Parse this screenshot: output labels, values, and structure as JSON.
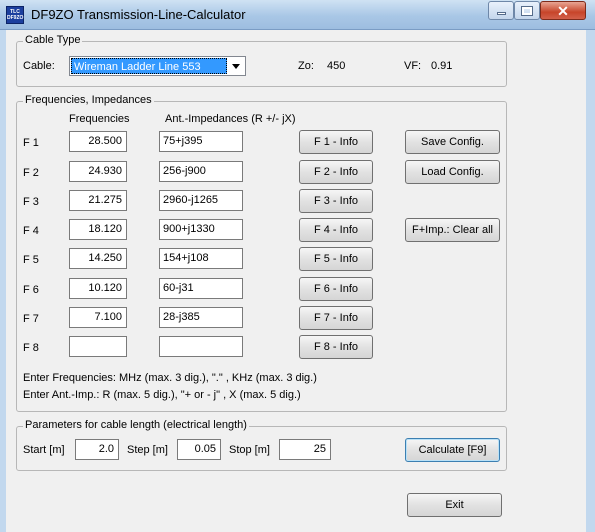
{
  "window": {
    "title": "DF9ZO Transmission-Line-Calculator",
    "icon_lines": [
      "TLC",
      "DF9ZO"
    ]
  },
  "cable_group": {
    "legend": "Cable Type",
    "cable_label": "Cable:",
    "cable_value": "Wireman Ladder Line 553",
    "zo_label": "Zo:",
    "zo_value": "450",
    "vf_label": "VF:",
    "vf_value": "0.91"
  },
  "freq_group": {
    "legend": "Frequencies, Impedances",
    "col_freq": "Frequencies",
    "col_imp": "Ant.-Impedances (R +/- jX)",
    "rows": [
      {
        "label": "F 1",
        "freq": "28.500",
        "imp": "75+j395",
        "info": "F 1 - Info"
      },
      {
        "label": "F 2",
        "freq": "24.930",
        "imp": "256-j900",
        "info": "F 2 - Info"
      },
      {
        "label": "F 3",
        "freq": "21.275",
        "imp": "2960-j1265",
        "info": "F 3 - Info"
      },
      {
        "label": "F 4",
        "freq": "18.120",
        "imp": "900+j1330",
        "info": "F 4 - Info"
      },
      {
        "label": "F 5",
        "freq": "14.250",
        "imp": "154+j108",
        "info": "F 5 - Info"
      },
      {
        "label": "F 6",
        "freq": "10.120",
        "imp": "60-j31",
        "info": "F 6 - Info"
      },
      {
        "label": "F 7",
        "freq": "7.100",
        "imp": "28-j385",
        "info": "F 7 - Info"
      },
      {
        "label": "F 8",
        "freq": "",
        "imp": "",
        "info": "F 8 - Info"
      }
    ],
    "save_config": "Save Config.",
    "load_config": "Load Config.",
    "clear_all": "F+Imp.: Clear all",
    "hint1": "Enter Frequencies: MHz (max. 3 dig.), \".\" , KHz (max. 3 dig.)",
    "hint2": "Enter Ant.-Imp.: R (max. 5 dig.), \"+ or - j\" , X (max. 5 dig.)"
  },
  "length_group": {
    "legend": "Parameters for cable length (electrical length)",
    "start_label": "Start [m]",
    "start_value": "2.0",
    "step_label": "Step [m]",
    "step_value": "0.05",
    "stop_label": "Stop [m]",
    "stop_value": "25",
    "calculate": "Calculate [F9]"
  },
  "exit": "Exit",
  "colors": {
    "selection": "#3399ff",
    "titlebar": "#a9c7e6",
    "close_button": "#c7452a",
    "dialog_bg": "#f0f0f0"
  }
}
